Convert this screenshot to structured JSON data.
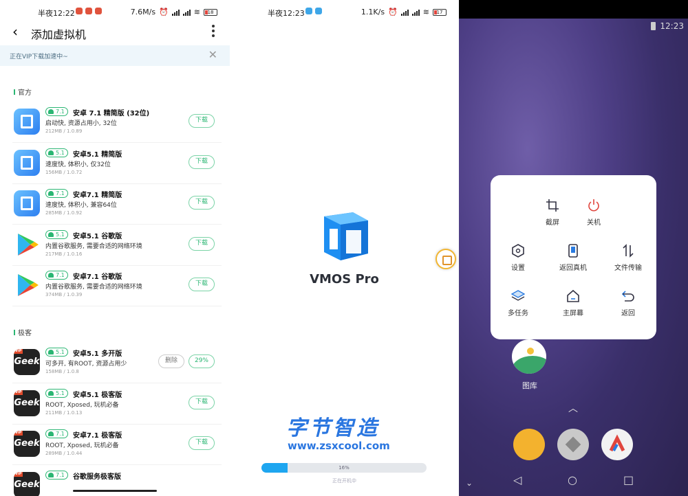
{
  "panel1": {
    "status": {
      "time": "半夜12:22",
      "speed": "7.6M/s",
      "battery": "18"
    },
    "header": {
      "back_icon": "back-arrow-icon",
      "title": "添加虚拟机",
      "more_icon": "more-vertical-icon"
    },
    "vip_banner": {
      "text": "正在VIP下载加速中~",
      "close_icon": "close-icon"
    },
    "sections": [
      {
        "title": "官方"
      },
      {
        "title": "极客"
      }
    ],
    "official_items": [
      {
        "icon": "vmos-icon",
        "version": "7.1",
        "name": "安卓 7.1 精简版 (32位)",
        "desc": "启动快, 资源占用小, 32位",
        "meta": "212MB / 1.0.89",
        "button": "下载"
      },
      {
        "icon": "vmos-icon",
        "version": "5.1",
        "name": "安卓5.1 精简版",
        "desc": "速度快, 体积小, 仅32位",
        "meta": "156MB / 1.0.72",
        "button": "下载"
      },
      {
        "icon": "vmos-icon",
        "version": "7.1",
        "name": "安卓7.1 精简版",
        "desc": "速度快, 体积小, 兼容64位",
        "meta": "285MB / 1.0.92",
        "button": "下载"
      },
      {
        "icon": "google-play-icon",
        "version": "5.1",
        "name": "安卓5.1 谷歌版",
        "desc": "内置谷歌服务, 需要合适的网络环境",
        "meta": "217MB / 1.0.16",
        "button": "下载"
      },
      {
        "icon": "google-play-icon",
        "version": "7.1",
        "name": "安卓7.1 谷歌版",
        "desc": "内置谷歌服务, 需要合适的网络环境",
        "meta": "374MB / 1.0.39",
        "button": "下载"
      }
    ],
    "geek_items": [
      {
        "icon": "geek-icon",
        "version": "5.1",
        "name": "安卓5.1 多开版",
        "desc": "可多开, 有ROOT, 资源占用少",
        "meta": "158MB / 1.0.8",
        "delete": "删除",
        "button": "29%"
      },
      {
        "icon": "geek-icon",
        "version": "5.1",
        "name": "安卓5.1 极客版",
        "desc": "ROOT, Xposed, 玩机必备",
        "meta": "211MB / 1.0.13",
        "button": "下载"
      },
      {
        "icon": "geek-icon",
        "version": "7.1",
        "name": "安卓7.1 极客版",
        "desc": "ROOT, Xposed, 玩机必备",
        "meta": "289MB / 1.0.44",
        "button": "下载"
      },
      {
        "icon": "geek-icon",
        "version": "7.1",
        "name": "谷歌服务极客版",
        "desc": "",
        "meta": "",
        "button": ""
      }
    ],
    "geek_text": "Geek",
    "vip_tag": "VIP"
  },
  "panel2": {
    "status": {
      "time": "半夜12:23",
      "speed": "1.1K/s",
      "battery": "17"
    },
    "brand": "VMOS Pro",
    "watermark_title": "字节智造",
    "watermark_url": "www.zsxcool.com",
    "progress": {
      "value": 0.16,
      "label": "16%",
      "caption": "正在开机中"
    }
  },
  "panel3": {
    "time": "12:23",
    "menu": [
      {
        "icon": "crop-icon",
        "label": "截屏"
      },
      {
        "icon": "power-icon",
        "label": "关机"
      },
      {
        "icon": "settings-hexagon-icon",
        "label": "设置"
      },
      {
        "icon": "phone-icon",
        "label": "返回真机"
      },
      {
        "icon": "transfer-icon",
        "label": "文件传输"
      },
      {
        "icon": "layers-icon",
        "label": "多任务"
      },
      {
        "icon": "home-icon",
        "label": "主屏幕"
      },
      {
        "icon": "return-icon",
        "label": "返回"
      }
    ],
    "gallery_label": "图库",
    "colors": {
      "accent": "#2bb673",
      "progress": "#1ea6f0",
      "wallpaper": "#4e3f86"
    }
  }
}
